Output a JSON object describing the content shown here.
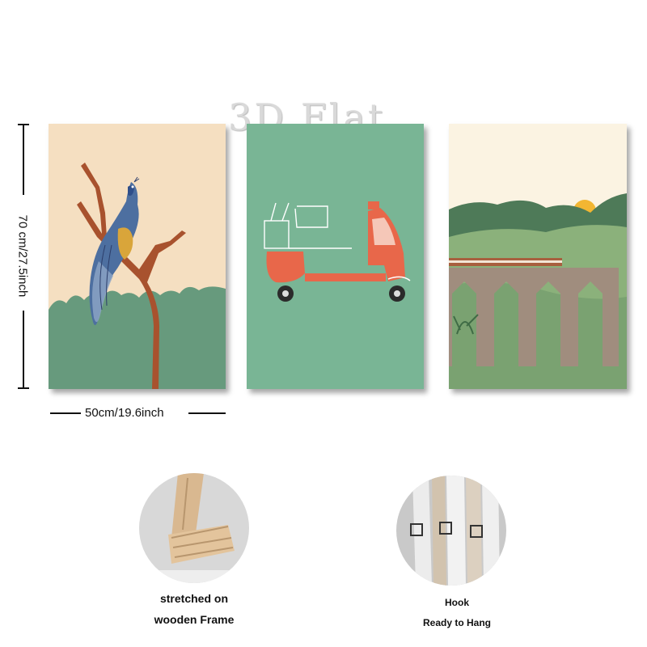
{
  "watermark": "3D Flat",
  "dimensions": {
    "height_label": "70 cm/27.5inch",
    "width_label": "50cm/19.6inch"
  },
  "panels": [
    {
      "subject": "peacock-on-branch",
      "colors": {
        "sky": "#f5dfc1",
        "ground": "#679a7d",
        "branch": "#a8522e"
      }
    },
    {
      "subject": "tuk-tuk",
      "colors": {
        "background": "#79b595",
        "vehicle": "#e8674a"
      }
    },
    {
      "subject": "train-on-viaduct",
      "colors": {
        "sky": "#fbf3e2",
        "hills": "#4e7a58",
        "sun": "#f2b632"
      }
    }
  ],
  "features": [
    {
      "caption_line1": "stretched on",
      "caption_line2": "wooden Frame"
    },
    {
      "caption_line1": "Hook",
      "caption_line2": "Ready to Hang"
    }
  ]
}
